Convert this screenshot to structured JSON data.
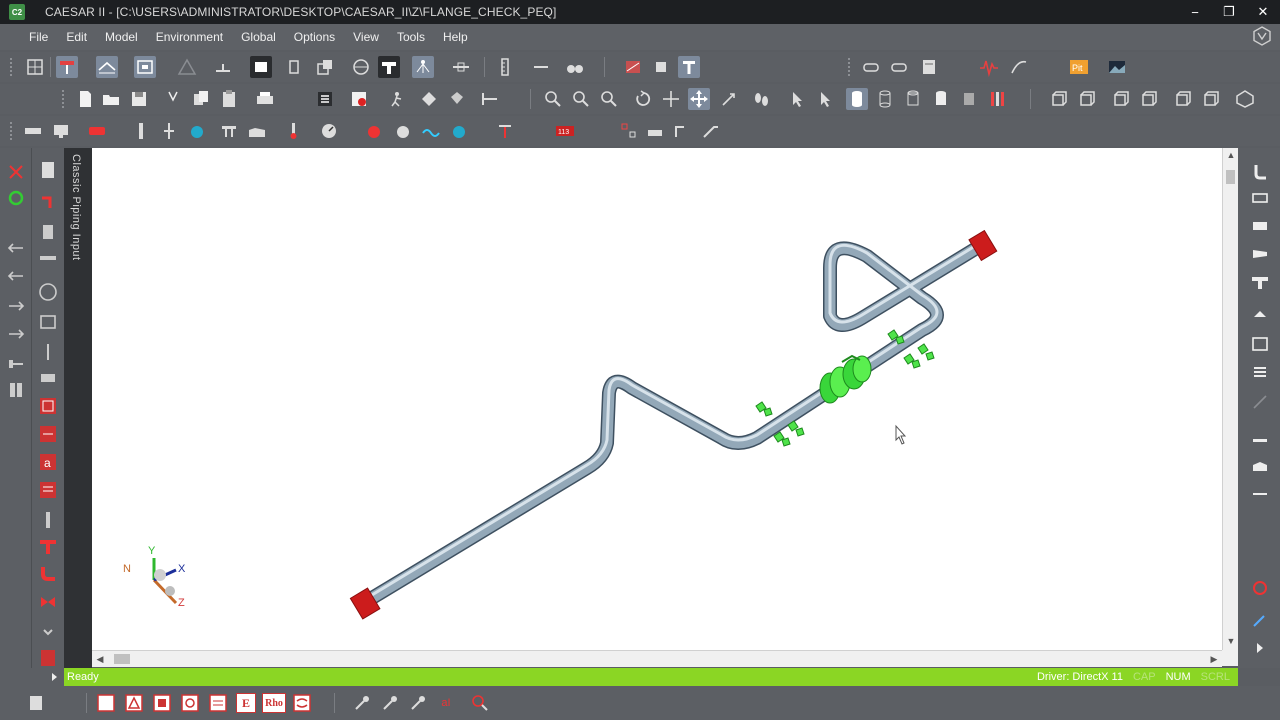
{
  "window": {
    "app_badge": "C2",
    "title": "CAESAR II - [C:\\USERS\\ADMINISTRATOR\\DESKTOP\\CAESAR_II\\Z\\FLANGE_CHECK_PEQ]",
    "min_label": "−",
    "restore_label": "❐",
    "close_label": "✕"
  },
  "menu": [
    "File",
    "Edit",
    "Model",
    "Environment",
    "Global",
    "Options",
    "View",
    "Tools",
    "Help"
  ],
  "side_tab": {
    "label": "Classic Piping Input"
  },
  "viewport": {
    "axis_labels": {
      "x": "X",
      "y": "Y",
      "z": "Z",
      "n": "N"
    },
    "colors": {
      "pipe": "#8fa3b3",
      "anchor": "#d01a1a",
      "component": "#3ee63a",
      "background": "#ffffff"
    }
  },
  "status": {
    "ready": "Ready",
    "driver": "Driver: DirectX 11",
    "caps": "CAP",
    "num": "NUM",
    "scrl": "SCRL"
  },
  "bottom_toolbar": {
    "labels": [
      "E",
      "Rho",
      "aI"
    ]
  }
}
